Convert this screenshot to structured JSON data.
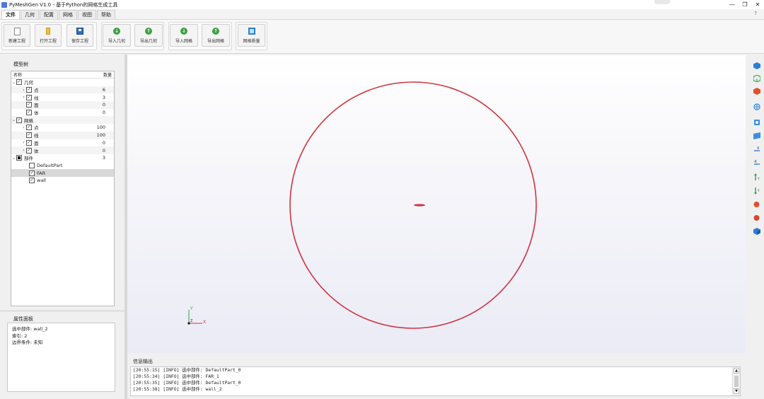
{
  "window": {
    "title": "PyMeshGen V1.0 - 基于Python的网格生成工具",
    "controls": {
      "minimize": "—",
      "maximize": "❐",
      "close": "✕"
    }
  },
  "menu": {
    "tabs": [
      "文件",
      "几何",
      "配置",
      "网格",
      "视图",
      "帮助"
    ],
    "active_index": 0,
    "help_glyph": "?"
  },
  "ribbon": {
    "new_project": "新建工程",
    "open_project": "打开工程",
    "save_project": "保存工程",
    "import_geometry": "导入几何",
    "export_geometry": "导出几何",
    "import_mesh": "导入网格",
    "export_mesh": "导出网格",
    "mesh_quality": "网格质量"
  },
  "model_tree": {
    "title": "模型树",
    "col_name": "名称",
    "col_count": "数量",
    "geometry": {
      "label": "几何",
      "children": [
        {
          "label": "点",
          "count": "6"
        },
        {
          "label": "线",
          "count": "3"
        },
        {
          "label": "面",
          "count": "0"
        },
        {
          "label": "体",
          "count": "0"
        }
      ]
    },
    "mesh": {
      "label": "网格",
      "children": [
        {
          "label": "点",
          "count": "100"
        },
        {
          "label": "线",
          "count": "100"
        },
        {
          "label": "面",
          "count": "0"
        },
        {
          "label": "体",
          "count": "0"
        }
      ]
    },
    "parts": {
      "label": "部件",
      "count": "3",
      "children": [
        {
          "label": "DefaultPart",
          "checked": false
        },
        {
          "label": "FAR",
          "checked": true
        },
        {
          "label": "wall",
          "checked": true
        }
      ]
    }
  },
  "properties": {
    "title": "属性面板",
    "selected_part": "选中部件: wall_2",
    "index": "索引: 2",
    "boundary": "边界条件: 未知"
  },
  "viewport": {
    "circle_color": "#d0343f",
    "airfoil_color": "#d0343f",
    "axis_y": "Y",
    "axis_z": "Z",
    "axis_x": "X"
  },
  "right_toolbar": {
    "icons": [
      "cube-solid-icon",
      "cube-wire-icon",
      "cube-red-icon",
      "zoom-fit-icon",
      "rotate-view-icon",
      "front-view-icon",
      "x-axis-view-icon",
      "neg-x-axis-view-icon",
      "y-axis-up-icon",
      "y-axis-down-icon",
      "z-axis-red-icon",
      "neg-z-axis-red-icon",
      "iso-view-icon"
    ]
  },
  "output": {
    "title": "信息输出",
    "lines": [
      "[20:55:15] [INFO] 选中部件: DefaultPart_0",
      "[20:55:34] [INFO] 选中部件: FAR_1",
      "[20:55:35] [INFO] 选中部件: DefaultPart_0",
      "[20:55:38] [INFO] 选中部件: wall_2"
    ]
  }
}
